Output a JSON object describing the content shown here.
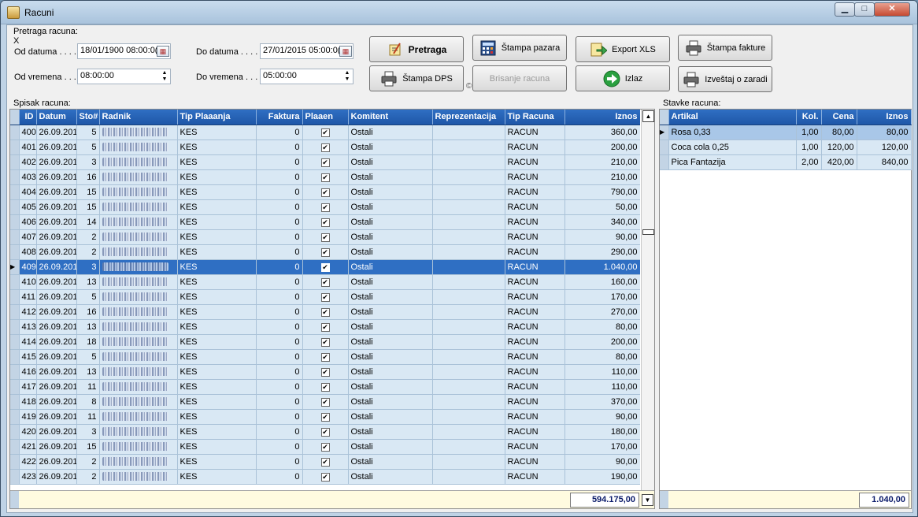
{
  "window": {
    "title": "Racuni"
  },
  "search": {
    "legend": "Pretraga racuna:",
    "x_mark": "X",
    "od_datuma_label": "Od datuma . . . .",
    "od_datuma_value": "18/01/1900 08:00:0(",
    "do_datuma_label": "Do datuma . . . .",
    "do_datuma_value": "27/01/2015 05:00:0(",
    "od_vremena_label": "Od vremena . . .",
    "od_vremena_value": "08:00:00",
    "do_vremena_label": "Do vremena . . .",
    "do_vremena_value": "05:00:00"
  },
  "toolbar": {
    "pretraga": "Pretraga",
    "stampa_pazara": "Štampa pazara",
    "export_xls": "Export XLS",
    "stampa_fakture": "Štampa fakture",
    "stampa_dps": "Štampa DPS",
    "brisanje_racuna": "Brisanje racuna",
    "izlaz": "Izlaz",
    "izvestaj_o_zaradi": "Izveštaj o zaradi",
    "copyright": "©"
  },
  "racuni": {
    "label": "Spisak racuna:",
    "columns": [
      "ID",
      "Datum",
      "Sto#",
      "Radnik",
      "Tip Plaaanja",
      "Faktura",
      "Plaaen",
      "Komitent",
      "Reprezentacija",
      "Tip Racuna",
      "Iznos"
    ],
    "selected_id": "409",
    "rows": [
      {
        "id": "400",
        "datum": "26.09.201",
        "sto": "5",
        "tip": "KES",
        "faktura": "0",
        "placen": true,
        "komitent": "Ostali",
        "tip_racuna": "RACUN",
        "iznos": "360,00"
      },
      {
        "id": "401",
        "datum": "26.09.201",
        "sto": "5",
        "tip": "KES",
        "faktura": "0",
        "placen": true,
        "komitent": "Ostali",
        "tip_racuna": "RACUN",
        "iznos": "200,00"
      },
      {
        "id": "402",
        "datum": "26.09.201",
        "sto": "3",
        "tip": "KES",
        "faktura": "0",
        "placen": true,
        "komitent": "Ostali",
        "tip_racuna": "RACUN",
        "iznos": "210,00"
      },
      {
        "id": "403",
        "datum": "26.09.201",
        "sto": "16",
        "tip": "KES",
        "faktura": "0",
        "placen": true,
        "komitent": "Ostali",
        "tip_racuna": "RACUN",
        "iznos": "210,00"
      },
      {
        "id": "404",
        "datum": "26.09.201",
        "sto": "15",
        "tip": "KES",
        "faktura": "0",
        "placen": true,
        "komitent": "Ostali",
        "tip_racuna": "RACUN",
        "iznos": "790,00"
      },
      {
        "id": "405",
        "datum": "26.09.201",
        "sto": "15",
        "tip": "KES",
        "faktura": "0",
        "placen": true,
        "komitent": "Ostali",
        "tip_racuna": "RACUN",
        "iznos": "50,00"
      },
      {
        "id": "406",
        "datum": "26.09.201",
        "sto": "14",
        "tip": "KES",
        "faktura": "0",
        "placen": true,
        "komitent": "Ostali",
        "tip_racuna": "RACUN",
        "iznos": "340,00"
      },
      {
        "id": "407",
        "datum": "26.09.201",
        "sto": "2",
        "tip": "KES",
        "faktura": "0",
        "placen": true,
        "komitent": "Ostali",
        "tip_racuna": "RACUN",
        "iznos": "90,00"
      },
      {
        "id": "408",
        "datum": "26.09.201",
        "sto": "2",
        "tip": "KES",
        "faktura": "0",
        "placen": true,
        "komitent": "Ostali",
        "tip_racuna": "RACUN",
        "iznos": "290,00"
      },
      {
        "id": "409",
        "datum": "26.09.201",
        "sto": "3",
        "tip": "KES",
        "faktura": "0",
        "placen": true,
        "komitent": "Ostali",
        "tip_racuna": "RACUN",
        "iznos": "1.040,00"
      },
      {
        "id": "410",
        "datum": "26.09.201",
        "sto": "13",
        "tip": "KES",
        "faktura": "0",
        "placen": true,
        "komitent": "Ostali",
        "tip_racuna": "RACUN",
        "iznos": "160,00"
      },
      {
        "id": "411",
        "datum": "26.09.201",
        "sto": "5",
        "tip": "KES",
        "faktura": "0",
        "placen": true,
        "komitent": "Ostali",
        "tip_racuna": "RACUN",
        "iznos": "170,00"
      },
      {
        "id": "412",
        "datum": "26.09.201",
        "sto": "16",
        "tip": "KES",
        "faktura": "0",
        "placen": true,
        "komitent": "Ostali",
        "tip_racuna": "RACUN",
        "iznos": "270,00"
      },
      {
        "id": "413",
        "datum": "26.09.201",
        "sto": "13",
        "tip": "KES",
        "faktura": "0",
        "placen": true,
        "komitent": "Ostali",
        "tip_racuna": "RACUN",
        "iznos": "80,00"
      },
      {
        "id": "414",
        "datum": "26.09.201",
        "sto": "18",
        "tip": "KES",
        "faktura": "0",
        "placen": true,
        "komitent": "Ostali",
        "tip_racuna": "RACUN",
        "iznos": "200,00"
      },
      {
        "id": "415",
        "datum": "26.09.201",
        "sto": "5",
        "tip": "KES",
        "faktura": "0",
        "placen": true,
        "komitent": "Ostali",
        "tip_racuna": "RACUN",
        "iznos": "80,00"
      },
      {
        "id": "416",
        "datum": "26.09.201",
        "sto": "13",
        "tip": "KES",
        "faktura": "0",
        "placen": true,
        "komitent": "Ostali",
        "tip_racuna": "RACUN",
        "iznos": "110,00"
      },
      {
        "id": "417",
        "datum": "26.09.201",
        "sto": "11",
        "tip": "KES",
        "faktura": "0",
        "placen": true,
        "komitent": "Ostali",
        "tip_racuna": "RACUN",
        "iznos": "110,00"
      },
      {
        "id": "418",
        "datum": "26.09.201",
        "sto": "8",
        "tip": "KES",
        "faktura": "0",
        "placen": true,
        "komitent": "Ostali",
        "tip_racuna": "RACUN",
        "iznos": "370,00"
      },
      {
        "id": "419",
        "datum": "26.09.201",
        "sto": "11",
        "tip": "KES",
        "faktura": "0",
        "placen": true,
        "komitent": "Ostali",
        "tip_racuna": "RACUN",
        "iznos": "90,00"
      },
      {
        "id": "420",
        "datum": "26.09.201",
        "sto": "3",
        "tip": "KES",
        "faktura": "0",
        "placen": true,
        "komitent": "Ostali",
        "tip_racuna": "RACUN",
        "iznos": "180,00"
      },
      {
        "id": "421",
        "datum": "26.09.201",
        "sto": "15",
        "tip": "KES",
        "faktura": "0",
        "placen": true,
        "komitent": "Ostali",
        "tip_racuna": "RACUN",
        "iznos": "170,00"
      },
      {
        "id": "422",
        "datum": "26.09.201",
        "sto": "2",
        "tip": "KES",
        "faktura": "0",
        "placen": true,
        "komitent": "Ostali",
        "tip_racuna": "RACUN",
        "iznos": "90,00"
      },
      {
        "id": "423",
        "datum": "26.09.201",
        "sto": "2",
        "tip": "KES",
        "faktura": "0",
        "placen": true,
        "komitent": "Ostali",
        "tip_racuna": "RACUN",
        "iznos": "190,00"
      }
    ],
    "total": "594.175,00"
  },
  "stavke": {
    "label": "Stavke racuna:",
    "columns": [
      "Artikal",
      "Kol.",
      "Cena",
      "Iznos"
    ],
    "rows": [
      {
        "artikal": "Rosa 0,33",
        "kol": "1,00",
        "cena": "80,00",
        "iznos": "80,00"
      },
      {
        "artikal": "Coca cola 0,25",
        "kol": "1,00",
        "cena": "120,00",
        "iznos": "120,00"
      },
      {
        "artikal": "Pica Fantazija",
        "kol": "2,00",
        "cena": "420,00",
        "iznos": "840,00"
      }
    ],
    "total": "1.040,00"
  },
  "icons": {
    "minimize": "minimize-icon",
    "maximize": "maximize-icon",
    "close": "close-icon"
  },
  "colors": {
    "header_blue": "#2f6fc3",
    "row_bg": "#d9e8f4",
    "footer_bg": "#fffbe0",
    "total_text": "#0a1a6a"
  }
}
